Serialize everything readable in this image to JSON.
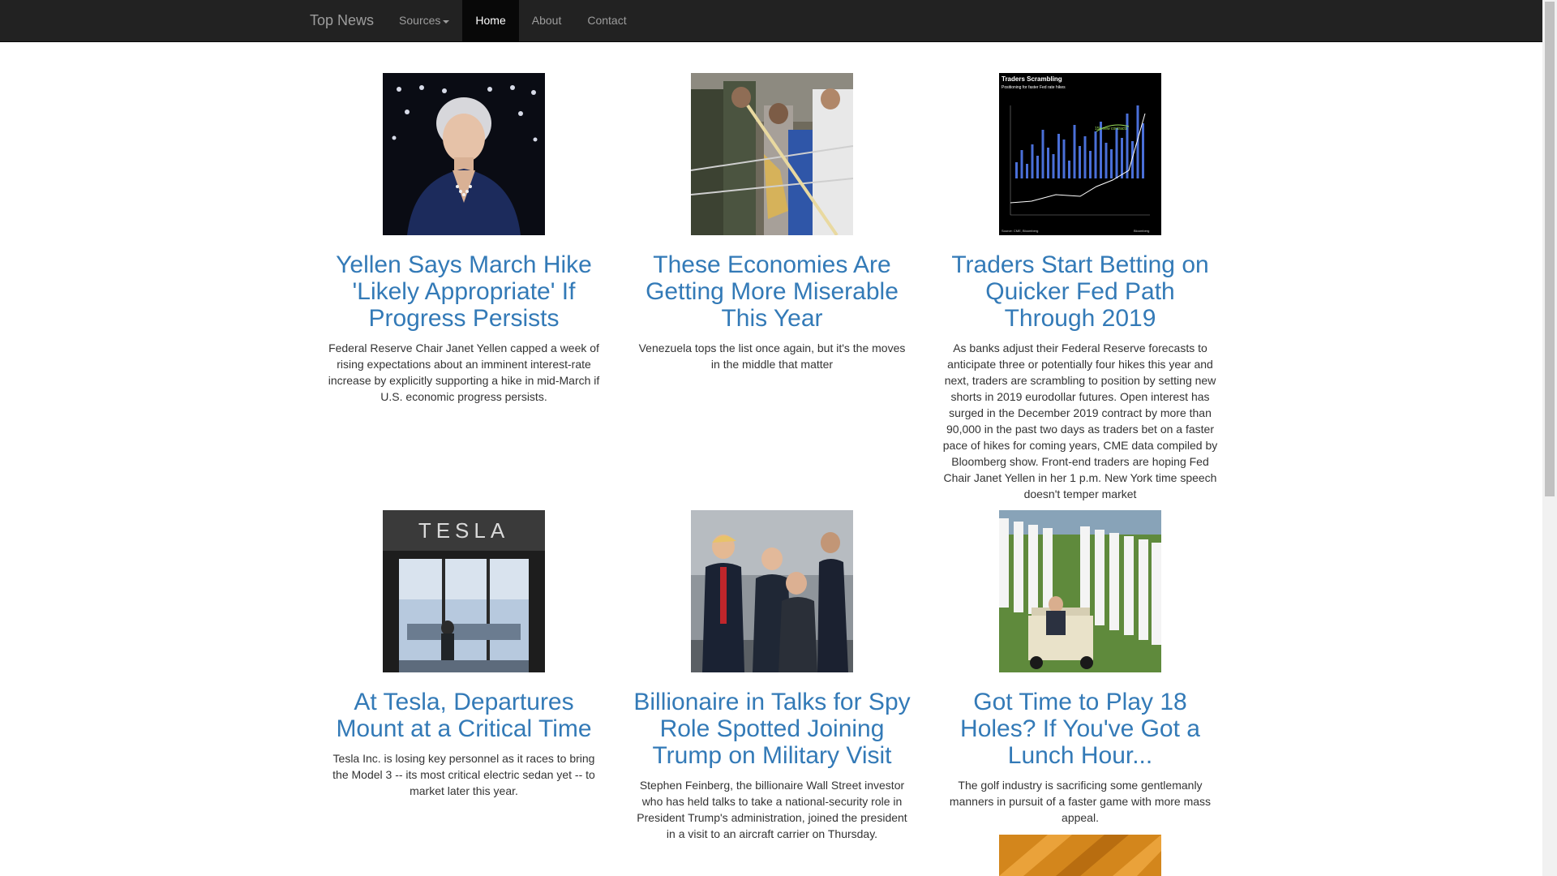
{
  "navbar": {
    "brand": "Top News",
    "items": [
      {
        "label": "Sources"
      },
      {
        "label": "Home"
      },
      {
        "label": "About"
      },
      {
        "label": "Contact"
      }
    ]
  },
  "articles": [
    {
      "title": "Yellen Says March Hike 'Likely Appropriate' If Progress Persists",
      "description": "Federal Reserve Chair Janet Yellen capped a week of rising expectations about an imminent interest-rate increase by explicitly supporting a hike in mid-March if U.S. economic progress persists."
    },
    {
      "title": "These Economies Are Getting More Miserable This Year",
      "description": "Venezuela tops the list once again, but it's the moves in the middle that matter"
    },
    {
      "title": "Traders Start Betting on Quicker Fed Path Through 2019",
      "description": "As banks adjust their Federal Reserve forecasts to anticipate three or potentially four hikes this year and next, traders are scrambling to position by setting new shorts in 2019 eurodollar futures. Open interest has surged in the December 2019 contract by more than 90,000 in the past two days as traders bet on a faster pace of hikes for coming years, CME data compiled by Bloomberg show. Front-end traders are hoping Fed Chair Janet Yellen in her 1 p.m. New York time speech doesn't temper market"
    },
    {
      "title": "At Tesla, Departures Mount at a Critical Time",
      "description": "Tesla Inc. is losing key personnel as it races to bring the Model 3 -- its most critical electric sedan yet -- to market later this year."
    },
    {
      "title": "Billionaire in Talks for Spy Role Spotted Joining Trump on Military Visit",
      "description": "Stephen Feinberg, the billionaire Wall Street investor who has held talks to take a national-security role in President Trump's administration, joined the president in a visit to an aircraft carrier on Thursday."
    },
    {
      "title": "Got Time to Play 18 Holes? If You've Got a Lunch Hour...",
      "description": "The golf industry is sacrificing some gentlemanly manners in pursuit of a faster game with more mass appeal."
    }
  ],
  "thumbnails": {
    "chart_title": "Traders Scrambling",
    "chart_subtitle": "Positioning for faster Fed rate hikes",
    "chart_annotation": "15k new contracts",
    "chart_source": "Source: CME, Bloomberg",
    "chart_brand": "Bloomberg",
    "tesla_sign": "TESLA"
  },
  "colors": {
    "navbar_bg": "#222222",
    "link": "#337ab7",
    "active_nav_bg": "#080808"
  }
}
